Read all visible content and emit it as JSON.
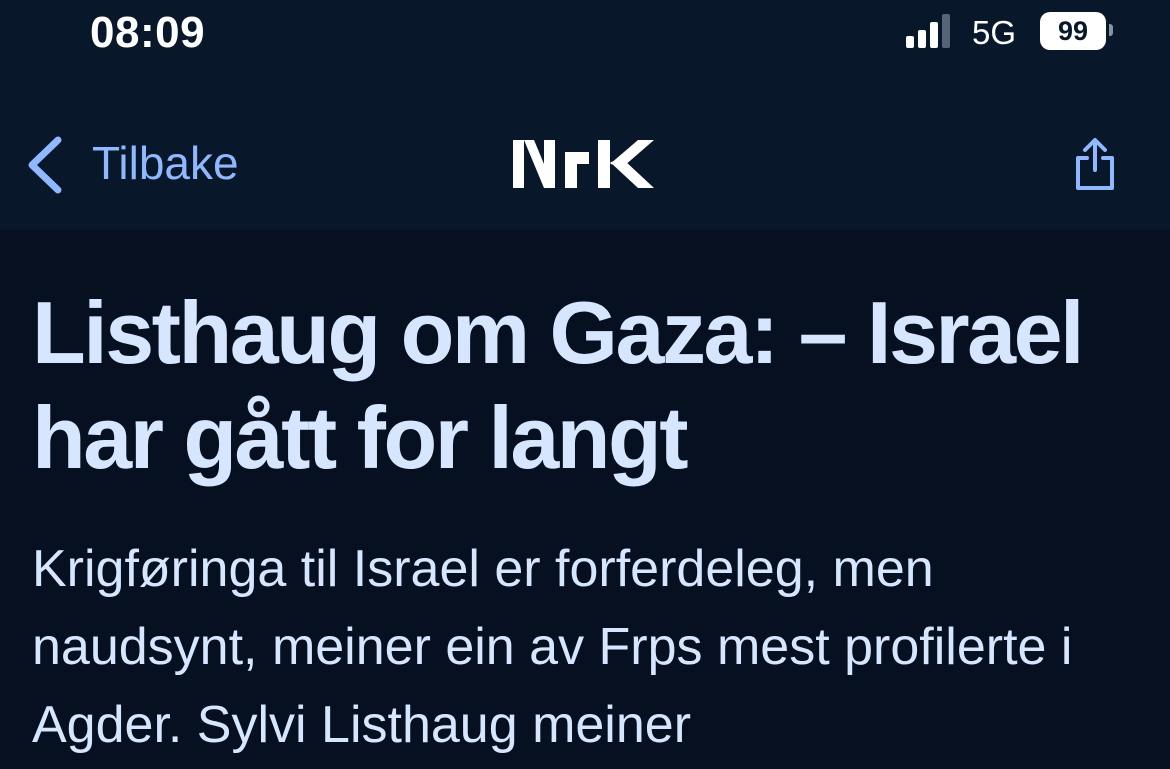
{
  "status_bar": {
    "time": "08:09",
    "network": "5G",
    "battery": "99",
    "signal_bars_active": 3,
    "signal_bars_total": 4
  },
  "nav": {
    "back_label": "Tilbake",
    "logo_text": "NRK",
    "share_icon": "share-icon"
  },
  "article": {
    "headline": "Listhaug om Gaza: – Israel har gått for langt",
    "lead": "Krigføringa til Israel er forferdeleg, men naudsynt, meiner ein av Frps mest profilerte i Agder. Sylvi Listhaug meiner"
  },
  "colors": {
    "background": "#061020",
    "nav_background": "#08172a",
    "accent": "#8fb8ff",
    "text": "#d7e6ff"
  }
}
